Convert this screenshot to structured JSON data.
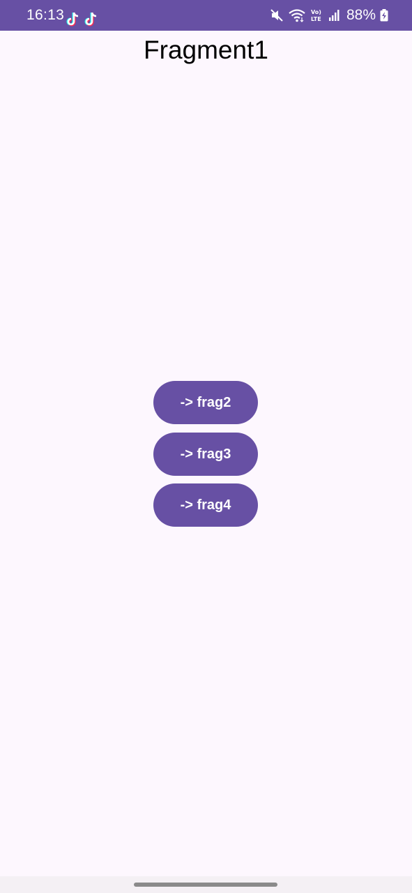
{
  "status_bar": {
    "time": "16:13",
    "battery": "88%",
    "icons": [
      "tiktok-icon",
      "tiktok-icon",
      "mute-icon",
      "wifi-icon",
      "volte-icon",
      "signal-icon",
      "battery-charging-icon"
    ],
    "background_color": "#6750a4"
  },
  "app": {
    "title": "Fragment1",
    "background_color": "#fdf7fe",
    "buttons": [
      {
        "label": "-> frag2"
      },
      {
        "label": "-> frag3"
      },
      {
        "label": "-> frag4"
      }
    ],
    "button_color": "#6750a4"
  }
}
